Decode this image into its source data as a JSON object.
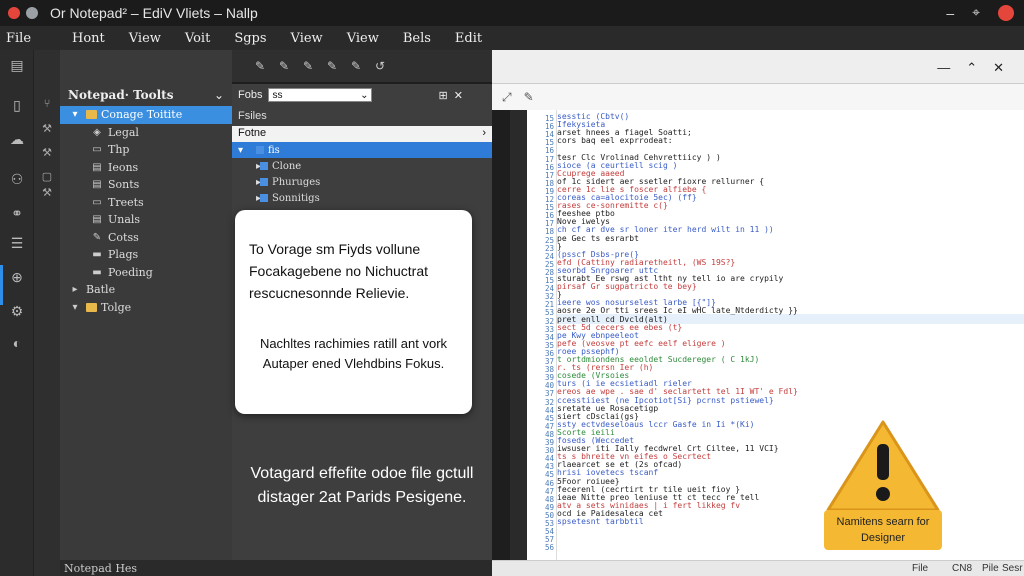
{
  "window": {
    "title": "Or Notepad² – EdiV Vliets – Nallp",
    "controls": {
      "minimize": "–",
      "maximize": "⌖"
    },
    "colors": {
      "close": "#e5463c",
      "selection": "#3b8fe0",
      "warning": "#f4b833"
    }
  },
  "menu": [
    "File",
    "Hont",
    "View",
    "Voit",
    "Sgps",
    "View",
    "View",
    "Bels",
    "Edit"
  ],
  "explorer": {
    "title": "Notepad· Toolts",
    "chevron": "⌄",
    "items": [
      {
        "label": "Conage Toitite",
        "icon": "chevron-down-icon",
        "folder": true,
        "selected": true,
        "indent": 0
      },
      {
        "label": "Legal",
        "icon": "cube-icon",
        "indent": 1
      },
      {
        "label": "Thp",
        "icon": "page-icon",
        "indent": 1
      },
      {
        "label": "Ieons",
        "icon": "list-icon",
        "indent": 1
      },
      {
        "label": "Sonts",
        "icon": "list-icon",
        "indent": 1
      },
      {
        "label": "Treets",
        "icon": "page-icon",
        "indent": 1
      },
      {
        "label": "Unals",
        "icon": "list-icon",
        "indent": 1
      },
      {
        "label": "Cotss",
        "icon": "pen-icon",
        "indent": 1
      },
      {
        "label": "Plags",
        "icon": "folder-icon",
        "indent": 1
      },
      {
        "label": "Poeding",
        "icon": "folder-icon",
        "indent": 1
      },
      {
        "label": "Batle",
        "icon": "chevron-right-icon",
        "indent": 0
      },
      {
        "label": "Tolge",
        "icon": "chevron-down-icon",
        "folder": true,
        "indent": 0
      }
    ]
  },
  "middle": {
    "search_label": "Fobs",
    "search_value": "ss",
    "subtitle": "Fsiles",
    "path": "Fotne",
    "path_arrow": "›",
    "rows": [
      {
        "label": "fis",
        "selected": true
      },
      {
        "label": "Clone"
      },
      {
        "label": "Phuruges"
      },
      {
        "label": "Sonnitigs"
      }
    ]
  },
  "dialog": {
    "lines": [
      "To Vorage sm Fiyds vollune",
      "Focakagebene no Nichuctrat",
      "rescucnesonnde Relievie."
    ],
    "lines2": [
      "Nachltes rachimies ratill ant vork",
      "Autaper ened Vlehdbins Fokus."
    ]
  },
  "caption": [
    "Votagard effefite odoe file gctull",
    "distager 2at Parids Pesigene."
  ],
  "editor": {
    "tools": [
      "⤢",
      "✎"
    ],
    "controls": [
      "—",
      "⌃",
      "✕"
    ],
    "line_numbers": [
      "15",
      "16",
      "14",
      "15",
      "16",
      "17",
      "16",
      "17",
      "18",
      "19",
      "12",
      "15",
      "16",
      "17",
      "18",
      "25",
      "23",
      "24",
      "25",
      "28",
      "15",
      "24",
      "32",
      "21",
      "53",
      "32",
      "33",
      "34",
      "35",
      "36",
      "37",
      "38",
      "39",
      "40",
      "37",
      "32",
      "44",
      "45",
      "47",
      "48",
      "39",
      "30",
      "44",
      "43",
      "45",
      "46",
      "47",
      "48",
      "49",
      "50",
      "53",
      "54",
      "57",
      "56",
      "55",
      "56"
    ],
    "code_lines": [
      {
        "text": "  sesstic  (Cbtv()",
        "color": "#3a5cc7"
      },
      {
        "text": "    Ifekysieta",
        "color": "#3a5cc7"
      },
      {
        "text": "      arset  hnees a  fiagel  Soatti;",
        "color": "#222"
      },
      {
        "text": "      cors  baq  eel  exprrodeat:",
        "color": "#222"
      },
      {
        "text": "",
        "color": "#222"
      },
      {
        "text": "    tesr  Clc  Vrolinad  Cehvrettiicy  )  )",
        "color": "#222"
      },
      {
        "text": "    sioce  (a  ceurtiell  scig  )",
        "color": "#3a5cc7"
      },
      {
        "text": "    Ccuprege  aaeed",
        "color": "#c43d3d"
      },
      {
        "text": "      of  1c  sidert  aer  ssetler  fioxre  rellurner  {",
        "color": "#222"
      },
      {
        "text": "      cerre  1c  lie  s  foscer  alfiebe  {",
        "color": "#c43d3d"
      },
      {
        "text": "      coreas  ca=alocitoie  5ec)  (ff}",
        "color": "#3a5cc7"
      },
      {
        "text": "      rases  ce-sonremitte  c(}",
        "color": "#c43d3d"
      },
      {
        "text": "      feeshee  ptbo",
        "color": "#222"
      },
      {
        "text": "      Nove  iwelys",
        "color": "#222"
      },
      {
        "text": "        ch  cf  ar  dve  sr  loner  iter  herd  wilt  in  11  ))",
        "color": "#3a5cc7"
      },
      {
        "text": "        pe  Gec  ts  esrarbt",
        "color": "#222"
      },
      {
        "text": "    }",
        "color": "#222"
      },
      {
        "text": "  (psscf  Dsbs-pre(}",
        "color": "#3a5cc7"
      },
      {
        "text": "    efd  (Cattiny  radiaretheitl,  (WS  19S?}",
        "color": "#c43d3d"
      },
      {
        "text": "    seorbd  Snrgoarer  uttc",
        "color": "#3a5cc7"
      },
      {
        "text": "    sturabt  Ee  rswg  ast  ltht  ny  tell  io  are  crypily",
        "color": "#222"
      },
      {
        "text": "    pirsaf  Gr  sugpatricto  te  bey}",
        "color": "#c43d3d"
      },
      {
        "text": "  }",
        "color": "#222"
      },
      {
        "text": "    ieere  wos  nosurselest  larbe  [{\"]}",
        "color": "#3a5cc7"
      },
      {
        "text": "    aosre  2e  Or  tti  srees  Ic  eI  wHC  late_Ntderdicty  }}",
        "color": "#222"
      },
      {
        "text": "      pret  enll  cd  Dvcld(alt)",
        "color": "#222"
      },
      {
        "text": "      sect  5d  cecers  ee  ebes  (t}",
        "color": "#c43d3d"
      },
      {
        "text": "    pe  Kwy  ebnpeeleot",
        "color": "#3a5cc7"
      },
      {
        "text": "    pefe  (veosve  pt  eefc  eelf  eligere  )",
        "color": "#c43d3d"
      },
      {
        "text": "  roee  pssephf)",
        "color": "#3a5cc7"
      },
      {
        "text": "    t  ortdmiondens  eeoldet  Sucdereger  (  C  1kJ)",
        "color": "#2e8b3a"
      },
      {
        "text": "    r.  ts  (rersn  Ier  (h)",
        "color": "#c43d3d"
      },
      {
        "text": "    cosede  (Vrsoies",
        "color": "#2e8b3a"
      },
      {
        "text": "      turs  (i  ie  ecsietiadl  rieler",
        "color": "#3a5cc7"
      },
      {
        "text": "      ereos  ae  wpe  .  sae  d'  seclartett  tel  1I  WT'  e  Fdl}",
        "color": "#c43d3d"
      },
      {
        "text": "      ccesstiiest  (ne  Ipcotiot[Si}  pcrnst  pstiewel}",
        "color": "#3a5cc7"
      },
      {
        "text": "      sretate  ue  Rosacetigp",
        "color": "#222"
      },
      {
        "text": "      siert  cDsclai(gs}",
        "color": "#222"
      },
      {
        "text": "      ssty  ectvdeseloaus  lccr  Gasfe  in  Ii  *(Ki)",
        "color": "#3a5cc7"
      },
      {
        "text": "      Scorte  ieili",
        "color": "#2e8b3a"
      },
      {
        "text": "      foseds  (Weccedet",
        "color": "#3a5cc7"
      },
      {
        "text": "        iwsuser  iti  Ially  fecdwrel  Crt  Ciltee,  11  VCI}",
        "color": "#222"
      },
      {
        "text": "        ts  s  bhreite  vn  eifes  o  Secrtect",
        "color": "#c43d3d"
      },
      {
        "text": "        rlaearcet  se  et  (2s  ofcad)",
        "color": "#222"
      },
      {
        "text": "        hrisi  iovetecs  tscanf",
        "color": "#3a5cc7"
      },
      {
        "text": "          5Foor  roiuee}",
        "color": "#222"
      },
      {
        "text": "    fecerenl  (cecrtirt  tr  tile  ueit  fioy  }",
        "color": "#222"
      },
      {
        "text": "      ieae  Nitte  preo  leniuse  tt  ct  tecc  re  tell",
        "color": "#222"
      },
      {
        "text": "      atv  a  sets  winidaes  |  i  fert  likkeg  fv",
        "color": "#c43d3d"
      },
      {
        "text": "      ocd  ie  Paidesaleca  cet",
        "color": "#222"
      },
      {
        "text": "      spsetesnt  tarbbtil",
        "color": "#3a5cc7"
      }
    ]
  },
  "warning": {
    "label": "Namitens searn for Designer",
    "icon": "warning-icon"
  },
  "status": {
    "left": "Notepad Hes",
    "items": [
      "File",
      "CN8",
      "Pile",
      "Sesr"
    ]
  }
}
